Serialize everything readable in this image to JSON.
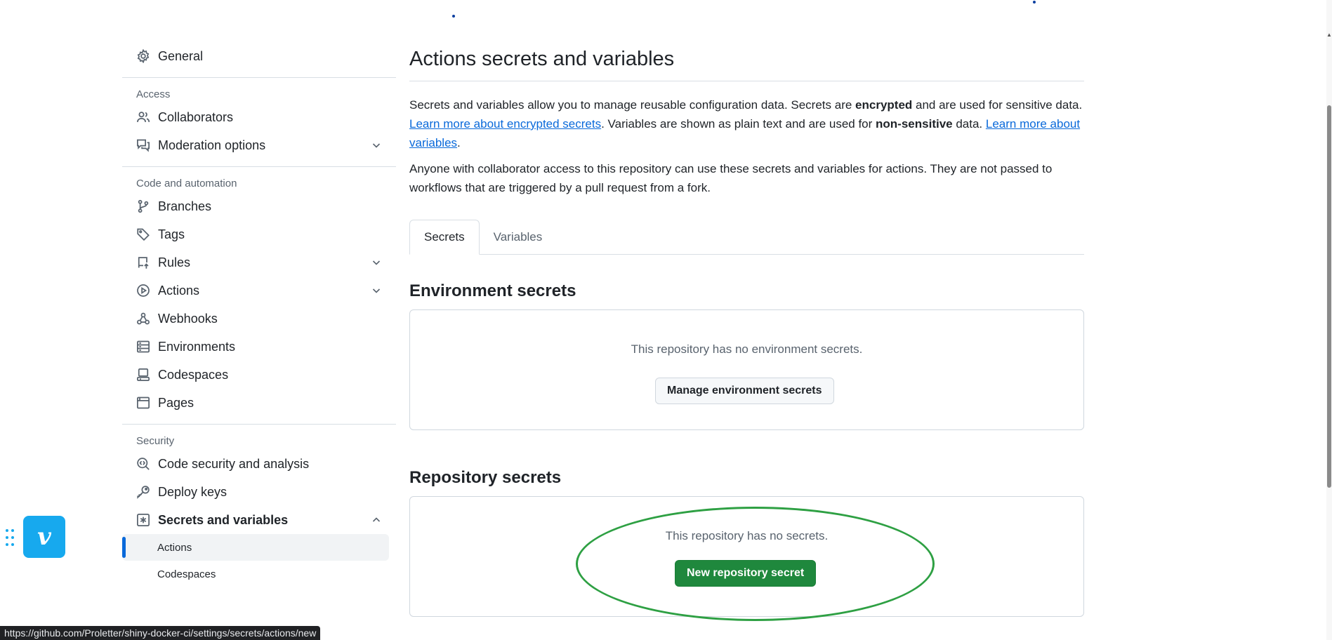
{
  "sidebar": {
    "general": "General",
    "groups": {
      "access": "Access",
      "code_automation": "Code and automation",
      "security": "Security"
    },
    "items": {
      "collaborators": "Collaborators",
      "moderation": "Moderation options",
      "branches": "Branches",
      "tags": "Tags",
      "rules": "Rules",
      "actions": "Actions",
      "webhooks": "Webhooks",
      "environments": "Environments",
      "codespaces": "Codespaces",
      "pages": "Pages",
      "code_security": "Code security and analysis",
      "deploy_keys": "Deploy keys",
      "secrets_vars": "Secrets and variables"
    },
    "sub_items": {
      "actions": "Actions",
      "codespaces": "Codespaces"
    }
  },
  "main": {
    "title": "Actions secrets and variables",
    "para1": {
      "t1": "Secrets and variables allow you to manage reusable configuration data. Secrets are ",
      "b1": "encrypted",
      "t2": " and are used for sensitive data. ",
      "link1": "Learn more about encrypted secrets",
      "t3": ". Variables are shown as plain text and are used for ",
      "b2": "non-sensitive",
      "t4": " data. ",
      "link2": "Learn more about variables",
      "t5": "."
    },
    "para2": "Anyone with collaborator access to this repository can use these secrets and variables for actions. They are not passed to workflows that are triggered by a pull request from a fork.",
    "tabs": [
      "Secrets",
      "Variables"
    ],
    "env_secrets": {
      "title": "Environment secrets",
      "empty": "This repository has no environment secrets.",
      "button": "Manage environment secrets"
    },
    "repo_secrets": {
      "title": "Repository secrets",
      "empty": "This repository has no secrets.",
      "button": "New repository secret"
    }
  },
  "status_bar": {
    "url": "https://github.com/Proletter/shiny-docker-ci/settings/secrets/actions/new"
  },
  "colors": {
    "primary_button": "#1f883d",
    "link": "#0969da",
    "highlight": "#2ea043",
    "active_indicator": "#0969da",
    "vimeo": "#17a9ee"
  }
}
